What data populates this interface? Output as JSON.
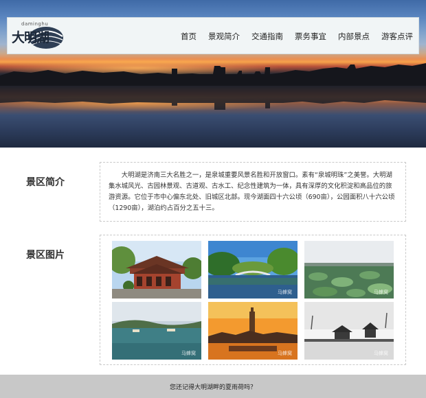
{
  "logo": {
    "text": "大明湖",
    "subtext": "daminghu"
  },
  "nav": {
    "items": [
      {
        "label": "首页"
      },
      {
        "label": "景观简介"
      },
      {
        "label": "交通指南"
      },
      {
        "label": "票务事宜"
      },
      {
        "label": "内部景点"
      },
      {
        "label": "游客点评"
      }
    ]
  },
  "intro": {
    "title": "景区简介",
    "text": "大明湖是济南三大名胜之一，是泉城重要风景名胜和开放窗口。素有“泉城明珠”之美誉。大明湖集水城风光、古园林景观、古道观、古水工、纪念性建筑为一体，具有深厚的文化积淀和高品位的旅游资源。它位于市中心偏东北处、旧城区北部。现今湖面四十六公顷（690亩），公园面积八十六公顷（1290亩），湖泊约占百分之五十三。"
  },
  "gallery": {
    "title": "景区图片",
    "watermark": "马蜂窝"
  },
  "footer": {
    "link_text": "您还记得大明湖畔的夏雨荷吗？"
  },
  "colors": {
    "navbar_bg": "#f1f5f6",
    "footer_bg": "#c8c8c8",
    "text": "#333333"
  },
  "icons": {
    "logo": "daminghu-logo-icon"
  }
}
